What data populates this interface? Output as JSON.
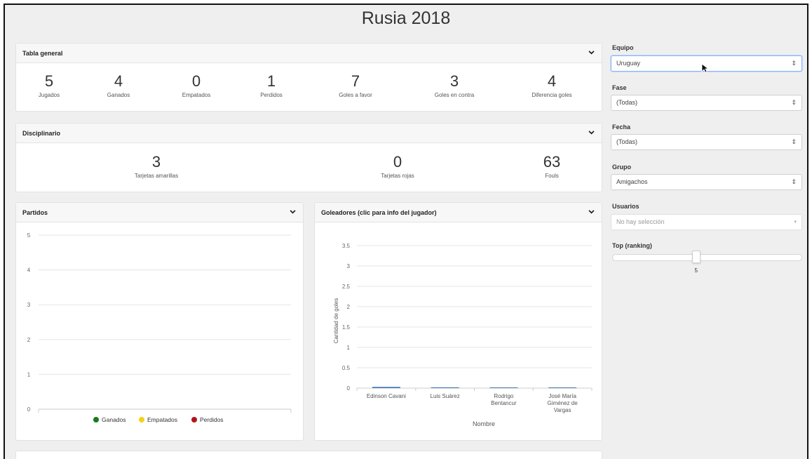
{
  "title": "Rusia 2018",
  "tabla_general": {
    "header": "Tabla general",
    "stats": [
      {
        "value": "5",
        "label": "Jugados"
      },
      {
        "value": "4",
        "label": "Ganados"
      },
      {
        "value": "0",
        "label": "Empatados"
      },
      {
        "value": "1",
        "label": "Perdidos"
      },
      {
        "value": "7",
        "label": "Goles a favor"
      },
      {
        "value": "3",
        "label": "Goles en contra"
      },
      {
        "value": "4",
        "label": "Diferencia goles"
      }
    ]
  },
  "disciplinario": {
    "header": "Disciplinario",
    "stats": [
      {
        "value": "3",
        "label": "Tarjetas amarillas"
      },
      {
        "value": "0",
        "label": "Tarjetas rojas"
      },
      {
        "value": "63",
        "label": "Fouls"
      }
    ]
  },
  "partidos": {
    "header": "Partidos",
    "legend": [
      {
        "label": "Ganados",
        "color": "#1a7a1a"
      },
      {
        "label": "Empatados",
        "color": "#f2d21b"
      },
      {
        "label": "Perdidos",
        "color": "#b0151b"
      }
    ]
  },
  "goleadores": {
    "header": "Goleadores (clic para info del jugador)",
    "bar_color": "#4a7ab5"
  },
  "sidebar": {
    "equipo_label": "Equipo",
    "equipo_value": "Uruguay",
    "fase_label": "Fase",
    "fase_value": "(Todas)",
    "fecha_label": "Fecha",
    "fecha_value": "(Todas)",
    "grupo_label": "Grupo",
    "grupo_value": "Amigachos",
    "usuarios_label": "Usuarios",
    "usuarios_placeholder": "No hay selección",
    "top_label": "Top (ranking)",
    "top_value": "5"
  },
  "chart_data": [
    {
      "type": "bar",
      "title": "",
      "xlabel": "",
      "ylabel": "",
      "ylim": [
        0,
        5
      ],
      "yticks": [
        "0",
        "1",
        "2",
        "3",
        "4",
        "5"
      ],
      "categories": [],
      "series": [
        {
          "name": "Ganados",
          "values": []
        },
        {
          "name": "Empatados",
          "values": []
        },
        {
          "name": "Perdidos",
          "values": []
        }
      ],
      "legend": "bottom"
    },
    {
      "type": "bar",
      "title": "",
      "xlabel": "Nombre",
      "ylabel": "Cantidad de goles",
      "ylim": [
        0,
        3.5
      ],
      "yticks": [
        "0",
        "0.5",
        "1",
        "1.5",
        "2",
        "2.5",
        "3",
        "3.5"
      ],
      "categories": [
        "Edinson Cavani",
        "Luis Suárez",
        "Rodrigo Bentancur",
        "José María Giménez de Vargas"
      ],
      "values": [
        0.03,
        0.02,
        0.01,
        0.01
      ]
    }
  ]
}
